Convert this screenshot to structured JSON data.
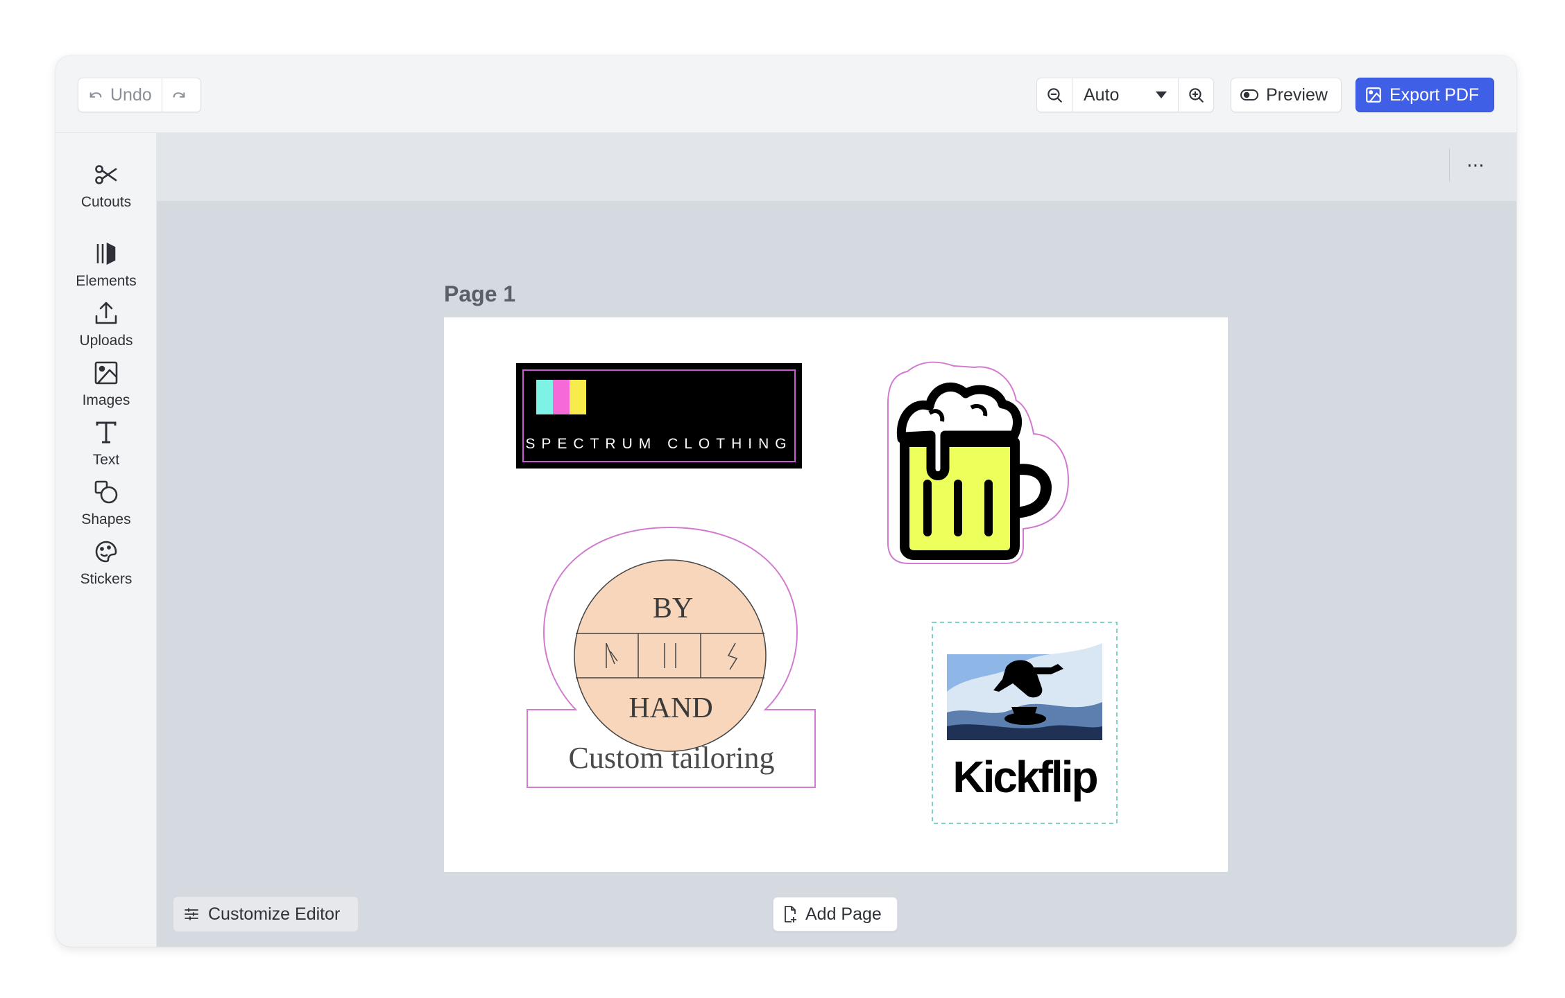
{
  "toolbar": {
    "undo_label": "Undo",
    "zoom_value": "Auto",
    "preview_label": "Preview",
    "export_label": "Export PDF"
  },
  "sidebar": {
    "items": [
      {
        "label": "Cutouts",
        "icon": "scissors-icon"
      },
      {
        "label": "Elements",
        "icon": "elements-icon"
      },
      {
        "label": "Uploads",
        "icon": "upload-icon"
      },
      {
        "label": "Images",
        "icon": "image-icon"
      },
      {
        "label": "Text",
        "icon": "text-icon"
      },
      {
        "label": "Shapes",
        "icon": "shapes-icon"
      },
      {
        "label": "Stickers",
        "icon": "sticker-icon"
      }
    ]
  },
  "canvas": {
    "page_label": "Page 1",
    "more_label": "⋯"
  },
  "stickers": {
    "spectrum": "SPECTRUM CLOTHING",
    "byhand_top": "BY",
    "byhand_bottom": "HAND",
    "byhand_caption": "Custom tailoring",
    "kickflip": "Kickflip"
  },
  "footer": {
    "customize_label": "Customize Editor",
    "add_page_label": "Add Page"
  },
  "colors": {
    "accent": "#3f5fe6",
    "cutline": "#d07ad0",
    "beer": "#ecff5a",
    "peach": "#f7d6bc"
  }
}
